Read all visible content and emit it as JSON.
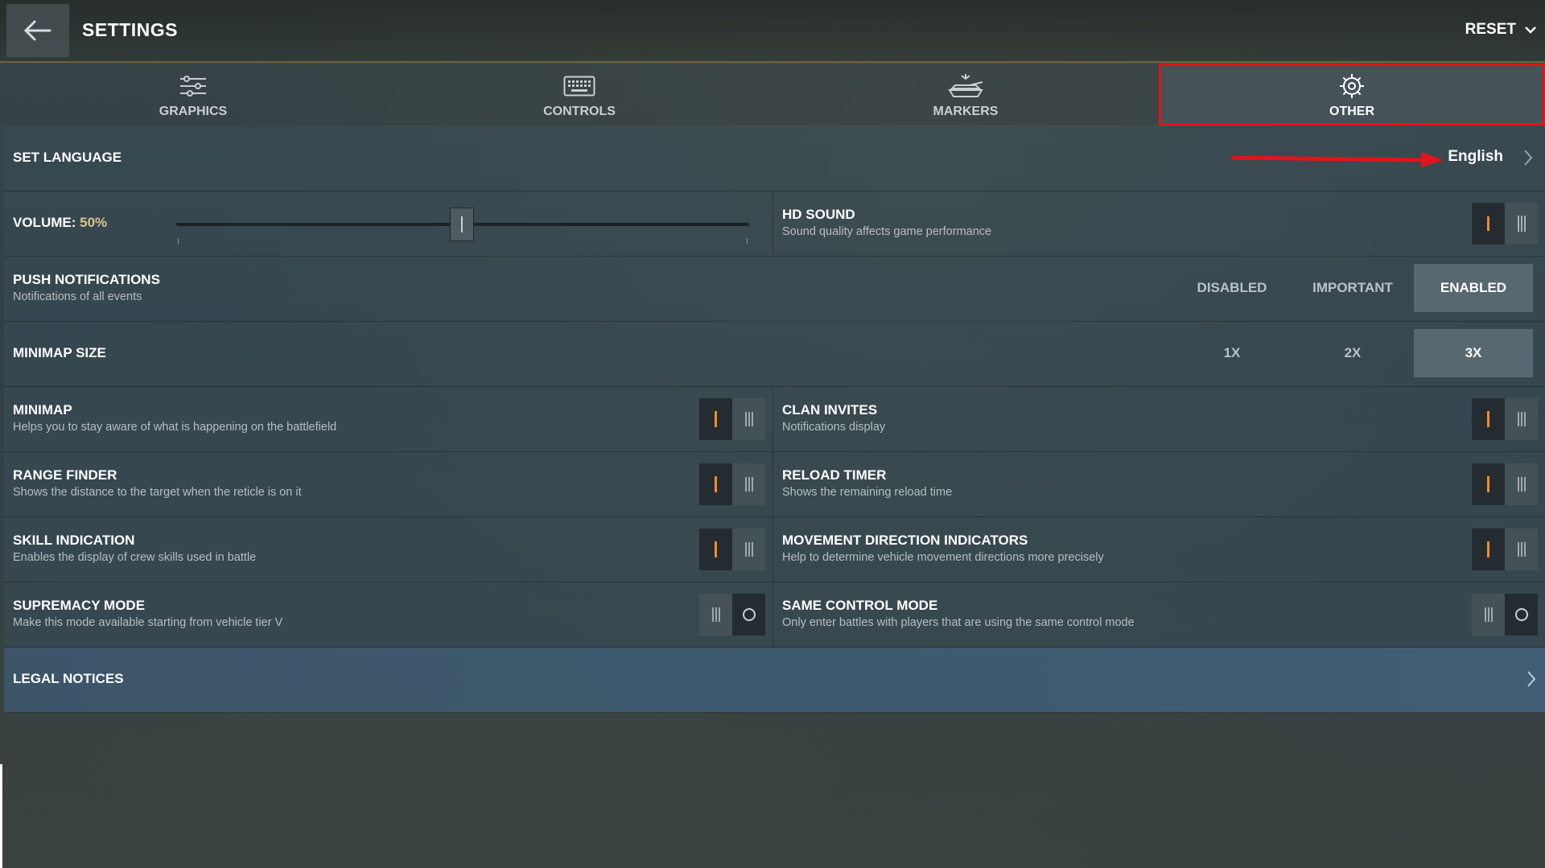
{
  "header": {
    "title": "SETTINGS",
    "reset_label": "RESET"
  },
  "tabs": [
    {
      "label": "GRAPHICS",
      "icon": "sliders-icon",
      "active": false
    },
    {
      "label": "CONTROLS",
      "icon": "keyboard-icon",
      "active": false
    },
    {
      "label": "MARKERS",
      "icon": "tank-icon",
      "active": false
    },
    {
      "label": "OTHER",
      "icon": "gear-icon",
      "active": true
    }
  ],
  "language": {
    "label": "SET LANGUAGE",
    "value": "English"
  },
  "volume": {
    "label": "VOLUME:",
    "value_text": "50%",
    "value": 50
  },
  "hd_sound": {
    "label": "HD SOUND",
    "desc": "Sound quality affects game performance",
    "on": true
  },
  "push": {
    "label": "PUSH NOTIFICATIONS",
    "desc": "Notifications of all events",
    "options": [
      "DISABLED",
      "IMPORTANT",
      "ENABLED"
    ],
    "selected": "ENABLED"
  },
  "minimap_size": {
    "label": "MINIMAP SIZE",
    "options": [
      "1X",
      "2X",
      "3X"
    ],
    "selected": "3X"
  },
  "toggles": {
    "minimap": {
      "label": "MINIMAP",
      "desc": "Helps you to stay aware of what is happening on the battlefield",
      "on": true
    },
    "clan_invites": {
      "label": "CLAN INVITES",
      "desc": "Notifications display",
      "on": true
    },
    "range_finder": {
      "label": "RANGE FINDER",
      "desc": "Shows the distance to the target when the reticle is on it",
      "on": true
    },
    "reload_timer": {
      "label": "RELOAD TIMER",
      "desc": "Shows the remaining reload time",
      "on": true
    },
    "skill_indication": {
      "label": "SKILL INDICATION",
      "desc": "Enables the display of crew skills used in battle",
      "on": true
    },
    "movement_indicators": {
      "label": "MOVEMENT DIRECTION INDICATORS",
      "desc": "Help to determine vehicle movement directions more precisely",
      "on": true
    },
    "supremacy_mode": {
      "label": "SUPREMACY MODE",
      "desc": "Make this mode available starting from vehicle tier V",
      "on": false
    },
    "same_control_mode": {
      "label": "SAME CONTROL MODE",
      "desc": "Only enter battles with players that are using the same control mode",
      "on": false
    }
  },
  "legal": {
    "label": "LEGAL NOTICES"
  },
  "colors": {
    "accent_on": "#f08a2c",
    "highlight_box": "#e0141c",
    "volume_value": "#d9c38a"
  }
}
